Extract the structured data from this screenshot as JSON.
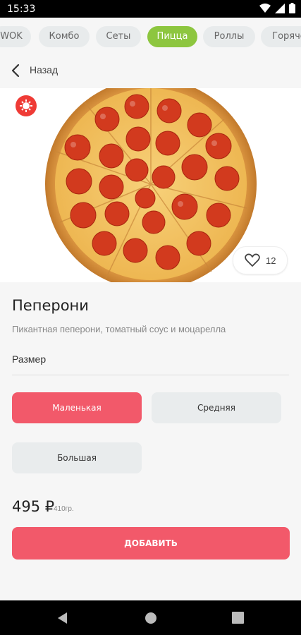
{
  "status_bar": {
    "time": "15:33"
  },
  "categories": [
    {
      "label": "WOK"
    },
    {
      "label": "Комбо"
    },
    {
      "label": "Сеты"
    },
    {
      "label": "Пицца"
    },
    {
      "label": "Роллы"
    },
    {
      "label": "Горяче"
    }
  ],
  "header": {
    "back_label": "Назад"
  },
  "product": {
    "like_count": "12",
    "name": "Пеперони",
    "description": "Пикантная пеперони, томатный соус и моцарелла",
    "size_label": "Размер",
    "sizes": [
      "Маленькая",
      "Средняя",
      "Большая"
    ],
    "price": "495 ₽",
    "weight": "410гр.",
    "add_label": "ДОБАВИТЬ"
  },
  "colors": {
    "accent_green": "#8dc63f",
    "accent_red": "#f2596a",
    "badge_red": "#ef3b36"
  }
}
